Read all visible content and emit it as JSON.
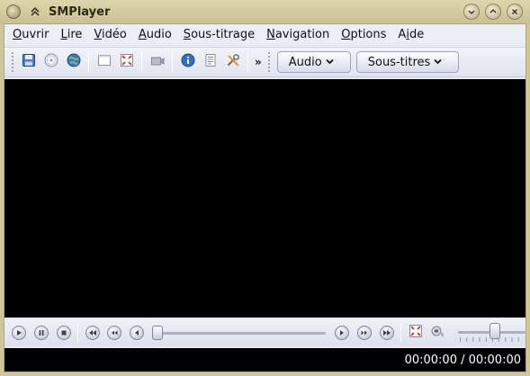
{
  "window": {
    "title": "SMPlayer"
  },
  "menubar": {
    "items": [
      {
        "id": "ouvrir",
        "u": "O",
        "rest": "uvrir"
      },
      {
        "id": "lire",
        "u": "L",
        "rest": "ire"
      },
      {
        "id": "video",
        "u": "V",
        "rest": "idéo"
      },
      {
        "id": "audio",
        "u": "A",
        "rest": "udio"
      },
      {
        "id": "sous-titrage",
        "u": "S",
        "rest": "ous-titrage"
      },
      {
        "id": "navigation",
        "u": "N",
        "rest": "avigation"
      },
      {
        "id": "options",
        "u": "O",
        "rest": "ptions"
      },
      {
        "pre": "A",
        "id": "aide",
        "u": "i",
        "rest": "de"
      }
    ]
  },
  "toolbar": {
    "overflow_label": "»",
    "audio_label": "Audio",
    "subtitles_label": "Sous-titres"
  },
  "status": {
    "time": "00:00:00 / 00:00:00"
  },
  "playback": {
    "seek_fraction": 0.0,
    "volume_fraction": 0.55
  },
  "colors": {
    "video_bg": "#000000",
    "accent_blue": "#2f6fc4",
    "frame_bg": "#e8ebf3",
    "title_bg": "#d6cfa6"
  }
}
